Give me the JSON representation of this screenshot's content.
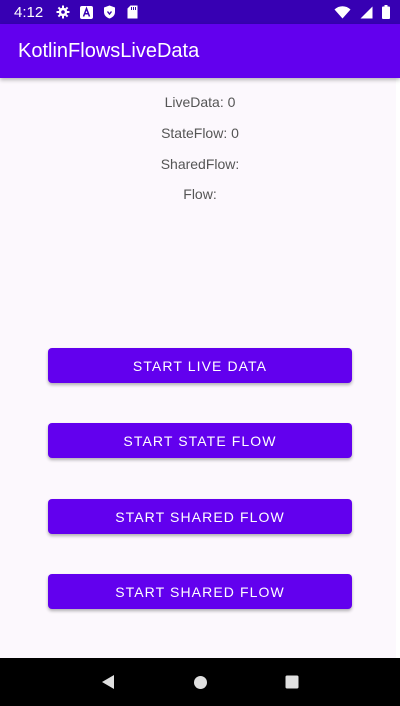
{
  "status_bar": {
    "time": "4:12",
    "icons": [
      "settings-icon",
      "a-badge-icon",
      "shield-icon",
      "sd-card-icon",
      "wifi-icon",
      "signal-icon",
      "battery-icon"
    ]
  },
  "app_bar": {
    "title": "KotlinFlowsLiveData"
  },
  "labels": {
    "live_data": "LiveData: 0",
    "state_flow": "StateFlow: 0",
    "shared_flow": "SharedFlow:",
    "flow": "Flow:"
  },
  "buttons": {
    "start_live_data": "START LIVE DATA",
    "start_state_flow": "START STATE FLOW",
    "start_shared_flow_1": "START SHARED FLOW",
    "start_shared_flow_2": "START SHARED FLOW"
  },
  "nav_bar": {
    "icons": [
      "back-icon",
      "home-icon",
      "recents-icon"
    ]
  },
  "colors": {
    "primary": "#6200EE",
    "primary_dark": "#3700B3",
    "background": "#FCF8FD",
    "label_text": "#555555"
  }
}
